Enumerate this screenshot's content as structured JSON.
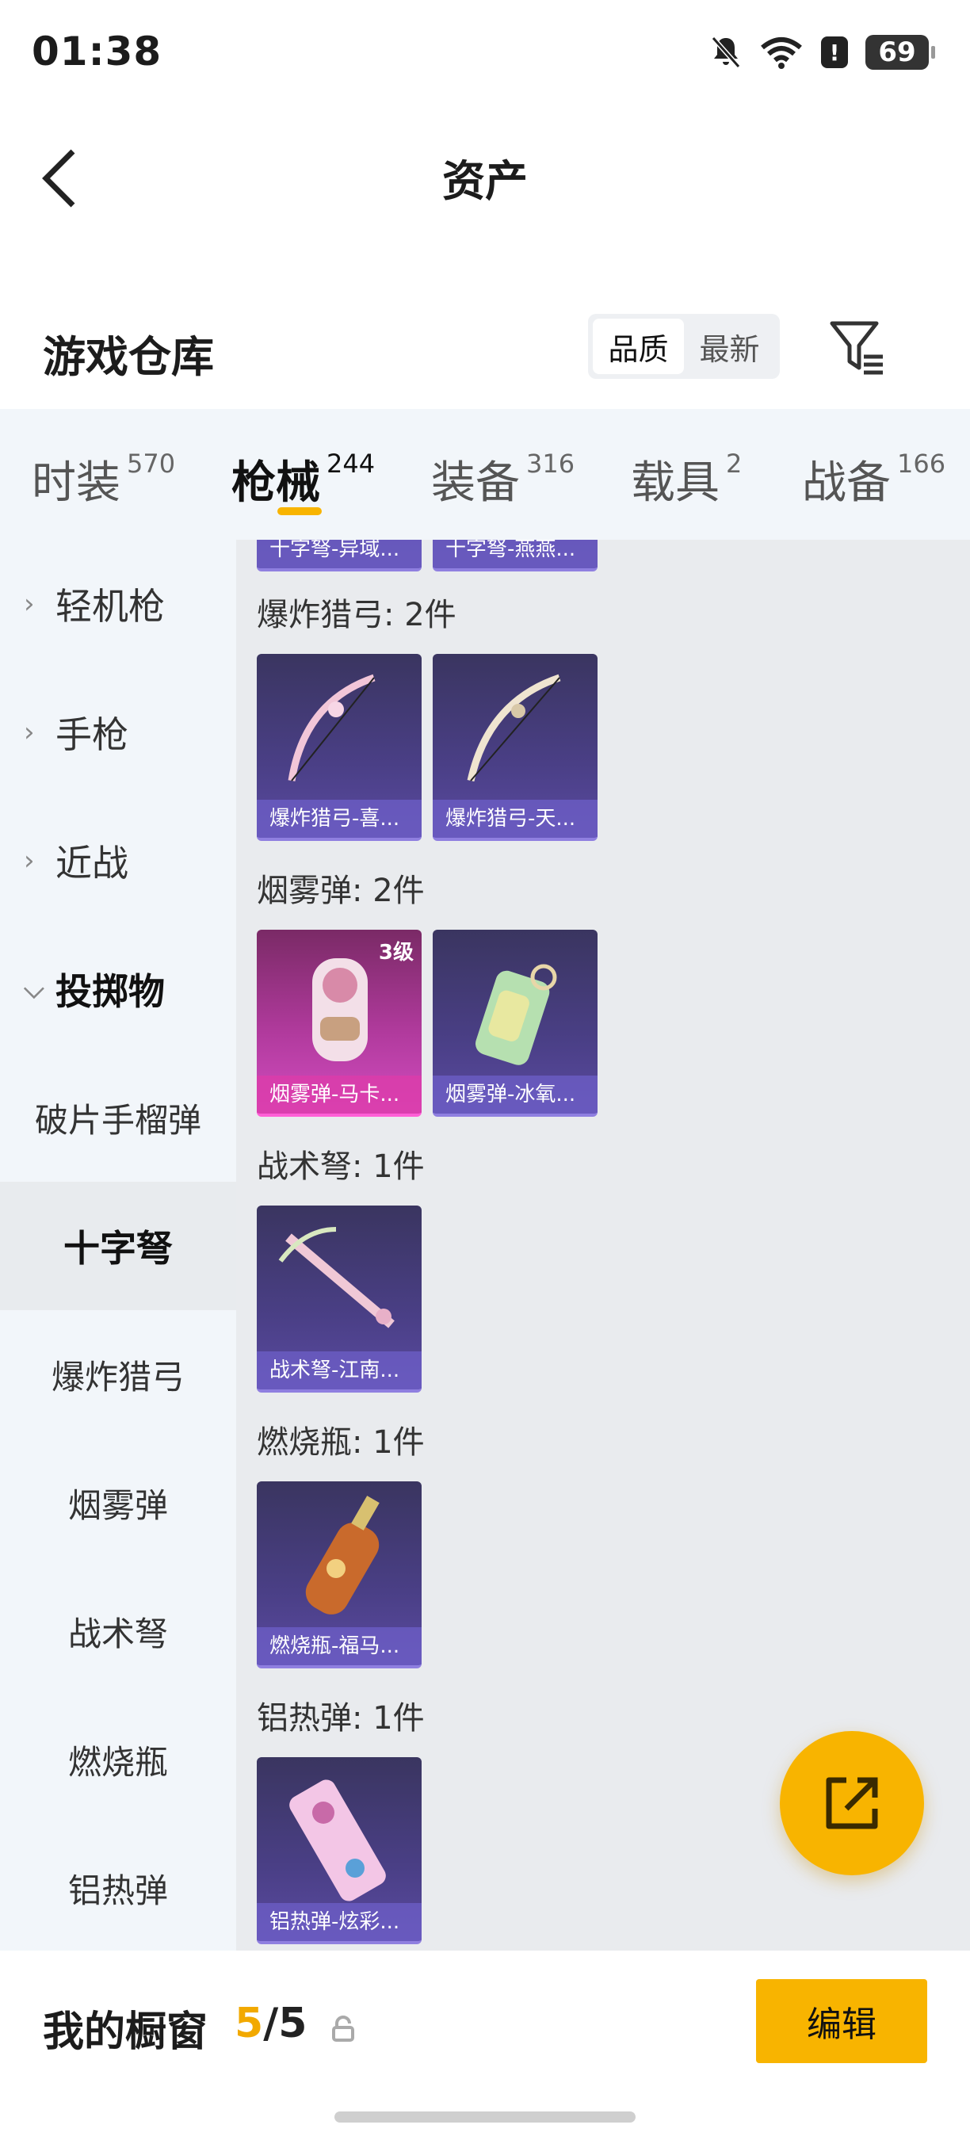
{
  "status_bar": {
    "time": "01:38",
    "battery": "69",
    "alert": "!"
  },
  "header": {
    "title": "资产"
  },
  "warehouse": {
    "title": "游戏仓库",
    "sort_options": [
      "品质",
      "最新"
    ],
    "sort_selected": "品质"
  },
  "tabs": [
    {
      "label": "时装",
      "count": "570"
    },
    {
      "label": "枪械",
      "count": "244"
    },
    {
      "label": "装备",
      "count": "316"
    },
    {
      "label": "载具",
      "count": "2"
    },
    {
      "label": "战备",
      "count": "166"
    }
  ],
  "active_tab": "枪械",
  "sidebar": {
    "groups": [
      {
        "label": "轻机枪"
      },
      {
        "label": "手枪"
      },
      {
        "label": "近战"
      },
      {
        "label": "投掷物"
      }
    ],
    "subitems": [
      {
        "label": "破片手榴弹"
      },
      {
        "label": "十字弩"
      },
      {
        "label": "爆炸猎弓"
      },
      {
        "label": "烟雾弹"
      },
      {
        "label": "战术弩"
      },
      {
        "label": "燃烧瓶"
      },
      {
        "label": "铝热弹"
      }
    ],
    "selected": "十字弩"
  },
  "sections": [
    {
      "title": "爆炸猎弓: 2件",
      "items": [
        {
          "name": "爆炸猎弓-喜..."
        },
        {
          "name": "爆炸猎弓-天..."
        }
      ]
    },
    {
      "title": "烟雾弹: 2件",
      "items": [
        {
          "name": "烟雾弹-马卡...",
          "level": "3级"
        },
        {
          "name": "烟雾弹-冰氧..."
        }
      ]
    },
    {
      "title": "战术弩: 1件",
      "items": [
        {
          "name": "战术弩-江南..."
        }
      ]
    },
    {
      "title": "燃烧瓶: 1件",
      "items": [
        {
          "name": "燃烧瓶-福马..."
        }
      ]
    },
    {
      "title": "铝热弹: 1件",
      "items": [
        {
          "name": "铝热弹-炫彩..."
        }
      ]
    }
  ],
  "partial_items": [
    {
      "name": "十字弩-异域..."
    },
    {
      "name": "十字弩-燕燕..."
    }
  ],
  "bottom": {
    "label": "我的橱窗",
    "current": "5",
    "separator": "/",
    "total": "5",
    "edit_label": "编辑"
  },
  "colors": {
    "accent": "#f8b400",
    "card_purple": "#4a3f86",
    "card_pink": "#c040b0"
  }
}
